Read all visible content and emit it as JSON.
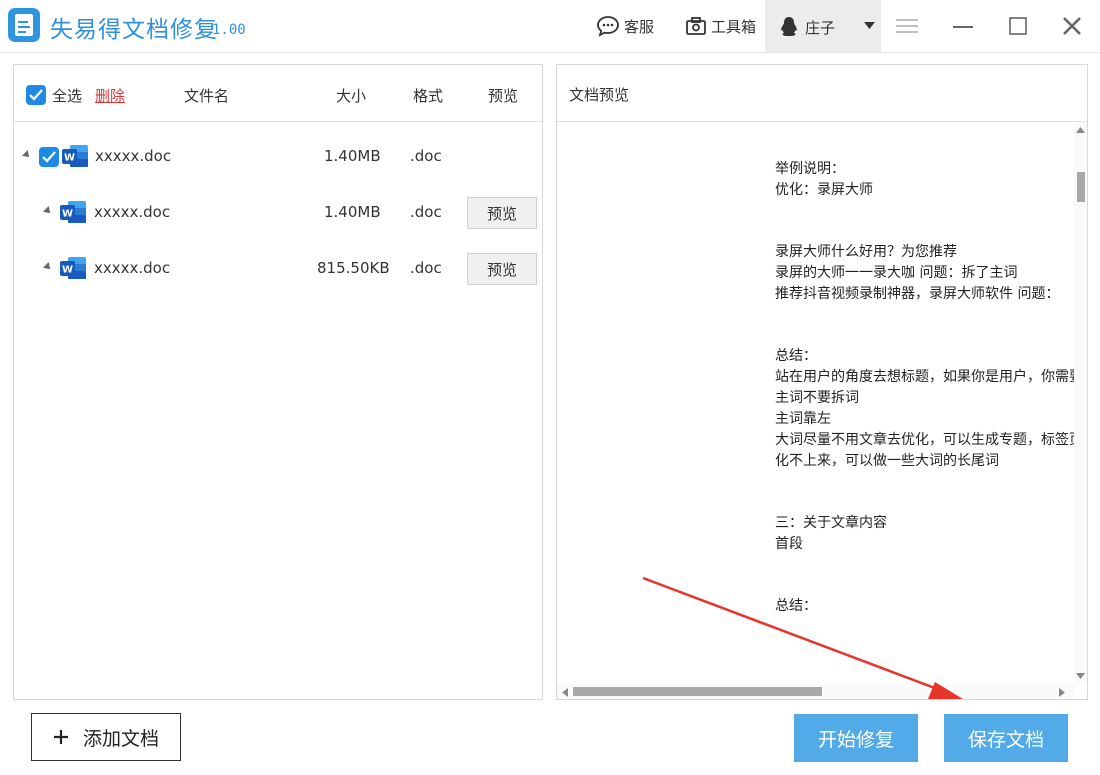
{
  "app": {
    "title": "失易得文档修复",
    "version": "1.00"
  },
  "toolbar": {
    "service_label": "客服",
    "toolbox_label": "工具箱",
    "user_name": "庄子"
  },
  "list": {
    "header": {
      "select_all_label": "全选",
      "delete_label": "删除",
      "col_name": "文件名",
      "col_size": "大小",
      "col_format": "格式",
      "col_preview": "预览"
    },
    "rows": [
      {
        "name": "xxxxx.doc",
        "size": "1.40MB",
        "format": ".doc",
        "preview": ""
      },
      {
        "name": "xxxxx.doc",
        "size": "1.40MB",
        "format": ".doc",
        "preview": "预览"
      },
      {
        "name": "xxxxx.doc",
        "size": "815.50KB",
        "format": ".doc",
        "preview": "预览"
      }
    ]
  },
  "preview": {
    "title": "文档预览",
    "lines": [
      "举例说明：",
      "优化：录屏大师",
      "录屏大师什么好用？为您推荐",
      "录屏的大师一一录大咖   问题：拆了主词",
      "推荐抖音视频录制神器，录屏大师软件      问题：",
      "总结：",
      "站在用户的角度去想标题，如果你是用户，你需要",
      "主词不要拆词",
      "主词靠左",
      "大词尽量不用文章去优化，可以生成专题，标签页",
      "化不上来，可以做一些大词的长尾词",
      "三：关于文章内容",
      "首段",
      "总结："
    ]
  },
  "actions": {
    "add_doc_label": "添加文档",
    "start_repair_label": "开始修复",
    "save_doc_label": "保存文档"
  },
  "colors": {
    "accent": "#2f8fe0",
    "button_blue": "#52abe8",
    "delete_red": "#d9363e",
    "annotation_arrow": "#e8352b"
  }
}
